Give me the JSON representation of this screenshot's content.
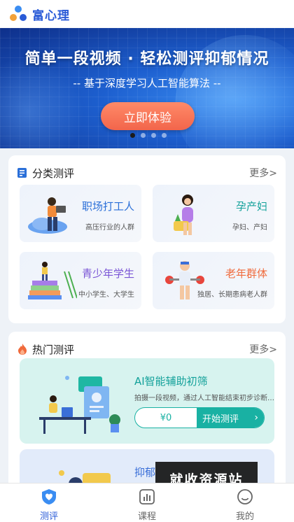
{
  "app": {
    "name": "富心理"
  },
  "banner": {
    "headline": "简单一段视频 · 轻松测评抑郁情况",
    "subheadline": "-- 基于深度学习人工智能算法 --",
    "cta_label": "立即体验",
    "slides_total": 4,
    "active_slide": 1
  },
  "categories": {
    "title": "分类测评",
    "more_label": "更多>",
    "items": [
      {
        "title": "职场打工人",
        "subtitle": "高压行业的人群",
        "title_color": "#2a6fd8"
      },
      {
        "title": "孕产妇",
        "subtitle": "孕妇、产妇",
        "title_color": "#13a19a"
      },
      {
        "title": "青少年学生",
        "subtitle": "中小学生、大学生",
        "title_color": "#7b56d6"
      },
      {
        "title": "老年群体",
        "subtitle": "独居、长期患病老人群",
        "title_color": "#f06a3b"
      }
    ]
  },
  "hot": {
    "title": "热门测评",
    "more_label": "更多>",
    "items": [
      {
        "title": "AI智能辅助初筛",
        "description": "拍摄一段视频，通过人工智能结束初步诊断…",
        "price": "¥0",
        "start_label": "开始测评",
        "go_icon": "›"
      },
      {
        "title": "抑郁"
      }
    ]
  },
  "watermark": "就收资源站",
  "tabs": [
    {
      "label": "测评",
      "active": true,
      "icon": "heart-shield-icon"
    },
    {
      "label": "课程",
      "active": false,
      "icon": "chart-icon"
    },
    {
      "label": "我的",
      "active": false,
      "icon": "smile-icon"
    }
  ],
  "colors": {
    "brand": "#2a5bd7",
    "teal": "#19b1a3",
    "cta": "#f2654b"
  }
}
